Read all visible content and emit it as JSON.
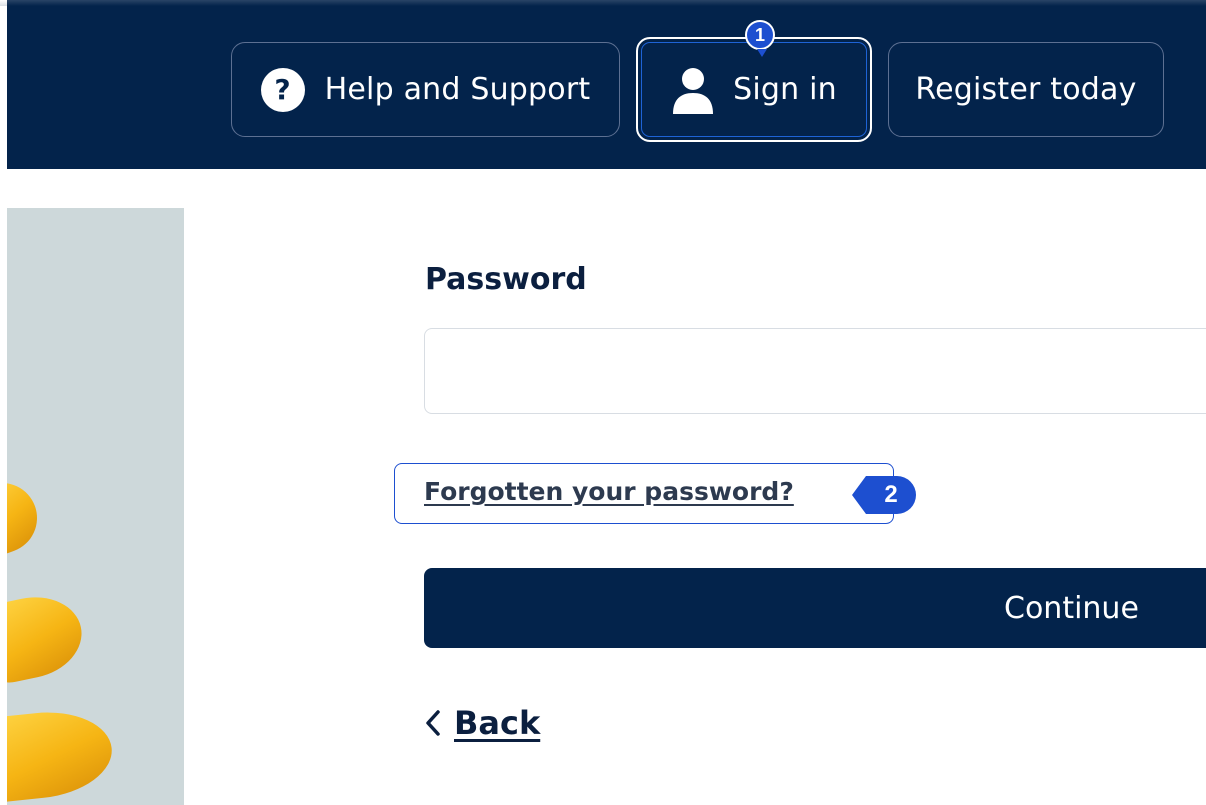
{
  "header": {
    "help_label": "Help and Support",
    "help_icon": "question-circle-icon",
    "signin_label": "Sign in",
    "signin_icon": "person-icon",
    "register_label": "Register today"
  },
  "annotations": {
    "step1": "1",
    "step2": "2"
  },
  "form": {
    "password_label": "Password",
    "password_value": "",
    "forgot_link": "Forgotten your password?",
    "continue_label": "Continue",
    "back_label": "Back",
    "back_icon": "chevron-left-icon"
  },
  "colors": {
    "header_bg": "#03234b",
    "accent_blue": "#1d4fd0",
    "side_panel": "#cdd8da",
    "pasta_yellow": "#f6b514"
  }
}
